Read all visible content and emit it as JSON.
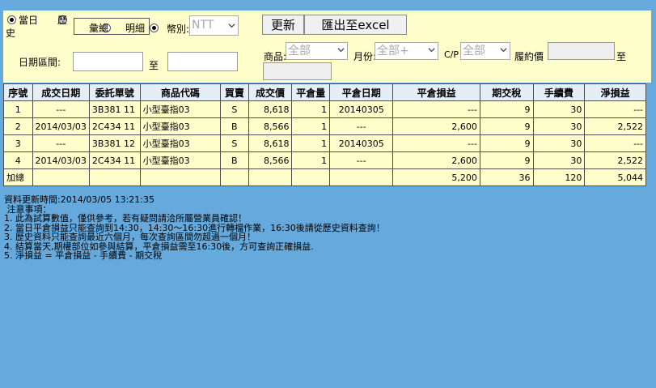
{
  "filters": {
    "radio_today": "當日",
    "radio_history_1": "歷",
    "radio_history_2": "史",
    "radio_summary": "彙總",
    "radio_detail": "明細",
    "currency_label": "幣別:",
    "currency_value": "NTT",
    "date_range_label": "日期區間:",
    "to_label": "至",
    "product_label": "商品:",
    "product_value": "全部",
    "month_label": "月份:",
    "month_value": "全部+",
    "cp_label": "C/P",
    "cp_value": "全部",
    "strike_label": "履約價",
    "strike_to_label": "至"
  },
  "buttons": {
    "refresh": "更新",
    "export": "匯出至excel"
  },
  "table": {
    "headers": [
      "序號",
      "成交日期",
      "委託單號",
      "商品代碼",
      "買賣",
      "成交價",
      "平倉量",
      "平倉日期",
      "平倉損益",
      "期交稅",
      "手續費",
      "淨損益"
    ],
    "rows": [
      [
        "1",
        "---",
        "3B381 11",
        "小型臺指03",
        "S",
        "8,618",
        "1",
        "20140305",
        "---",
        "9",
        "30",
        "---"
      ],
      [
        "2",
        "2014/03/03",
        "2C434 11",
        "小型臺指03",
        "B",
        "8,566",
        "1",
        "---",
        "2,600",
        "9",
        "30",
        "2,522"
      ],
      [
        "3",
        "---",
        "3B381 12",
        "小型臺指03",
        "S",
        "8,618",
        "1",
        "20140305",
        "---",
        "9",
        "30",
        "---"
      ],
      [
        "4",
        "2014/03/03",
        "2C434 11",
        "小型臺指03",
        "B",
        "8,566",
        "1",
        "---",
        "2,600",
        "9",
        "30",
        "2,522"
      ]
    ],
    "total": [
      "加總",
      "",
      "",
      "",
      "",
      "",
      "",
      "",
      "5,200",
      "36",
      "120",
      "5,044"
    ]
  },
  "notes": {
    "update_time": "資料更新時間:2014/03/05 13:21:35",
    "title": " 注意事項：",
    "lines": [
      "1. 此為試算數值，僅供參考，若有疑問請洽所屬營業員確認！",
      "2. 當日平倉損益只能查詢到14:30，14:30～16:30進行轉檔作業，16:30後請從歷史資料查詢！",
      "3. 歷史資料只能查詢最近六個月，每次查詢區間勿超過一個月！",
      "4. 結算當天,期權部位如參與結算，平倉損益需至16:30後，方可查詢正確損益.",
      "5. 淨損益 = 平倉損益 - 手續費 - 期交稅"
    ]
  }
}
